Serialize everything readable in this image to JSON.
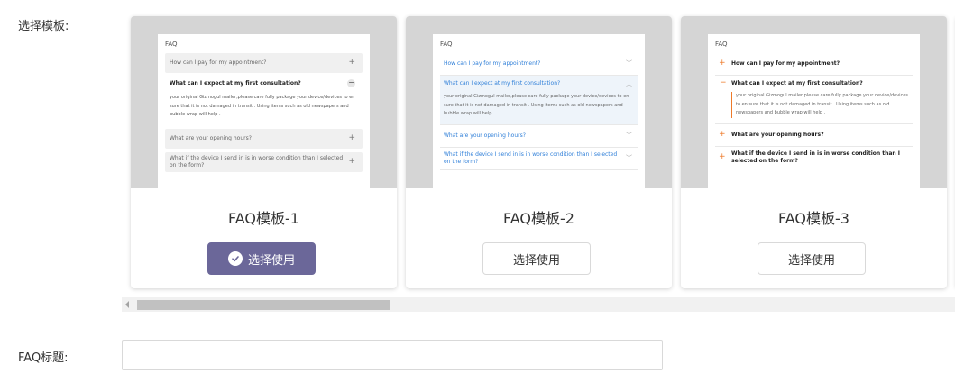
{
  "form": {
    "template_label": "选择模板:",
    "title_label": "FAQ标题:",
    "title_value": "",
    "title_placeholder": ""
  },
  "preview": {
    "heading": "FAQ",
    "questions": [
      "How can I pay for my appointment?",
      "What can I expect at my first consultation?",
      "What are your opening hours?",
      "What if the device I send in is in worse condition than I selected on the form?"
    ],
    "answer": "your original Gizmogul mailer,please care fully package your device/devices to en sure that it is not damaged in transit . Using items such as old newspapers and bubble wrap will help ."
  },
  "templates": [
    {
      "name": "FAQ模板-1",
      "button": "选择使用",
      "selected": true
    },
    {
      "name": "FAQ模板-2",
      "button": "选择使用",
      "selected": false
    },
    {
      "name": "FAQ模板-3",
      "button": "选择使用",
      "selected": false
    }
  ],
  "colors": {
    "primary_button": "#6b6799",
    "t2_link": "#2f7fd8",
    "t3_accent": "#ee7a2a"
  },
  "icons": {
    "selected_check": "check-circle-icon",
    "scroll_left": "triangle-left-icon"
  }
}
